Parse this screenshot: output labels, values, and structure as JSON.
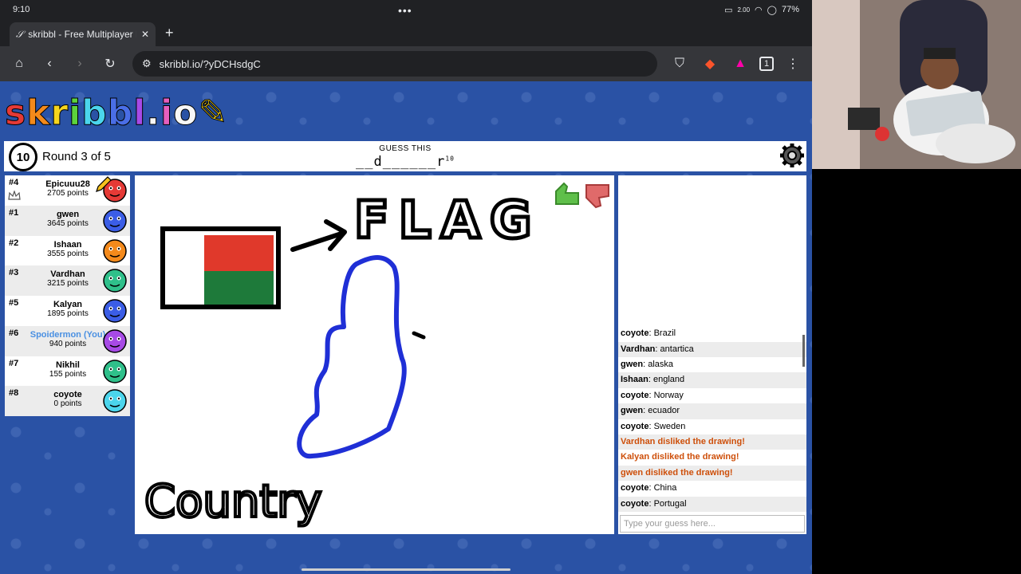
{
  "status": {
    "time": "9:10",
    "battery": "77%",
    "speed": "2.00"
  },
  "browser": {
    "tab_title": "skribbl - Free Multiplayer Drawing",
    "url": "skribbl.io/?yDCHsdgC"
  },
  "game": {
    "logo": [
      "s",
      "k",
      "r",
      "i",
      "b",
      "b",
      "l",
      ".",
      "i",
      "o"
    ],
    "logo_colors": [
      "#e53a36",
      "#f48a1b",
      "#f7d51d",
      "#5cd33c",
      "#4bd5ec",
      "#4a6ee6",
      "#a74ae6",
      ".",
      "#e55fbe",
      "#f7f7f7"
    ],
    "timer": "10",
    "round": "Round 3 of 5",
    "guess_label": "GUESS THIS",
    "hint": "__d______r",
    "hint_count": "10"
  },
  "players": [
    {
      "rank": "#4",
      "name": "Epicuuu28",
      "points": "2705 points",
      "color": "#e53a36"
    },
    {
      "rank": "#1",
      "name": "gwen",
      "points": "3645 points",
      "color": "#3b5de6"
    },
    {
      "rank": "#2",
      "name": "Ishaan",
      "points": "3555 points",
      "color": "#f48a1b"
    },
    {
      "rank": "#3",
      "name": "Vardhan",
      "points": "3215 points",
      "color": "#2fc08a"
    },
    {
      "rank": "#5",
      "name": "Kalyan",
      "points": "1895 points",
      "color": "#3b5de6"
    },
    {
      "rank": "#6",
      "name": "Spoidermon (You)",
      "points": "940 points",
      "color": "#a74ae6"
    },
    {
      "rank": "#7",
      "name": "Nikhil",
      "points": "155 points",
      "color": "#2fc08a"
    },
    {
      "rank": "#8",
      "name": "coyote",
      "points": "0 points",
      "color": "#4bd5ec"
    }
  ],
  "canvas": {
    "text_flag": "FLAG",
    "text_country": "Country",
    "flag_colors": [
      "#ffffff",
      "#e0392b",
      "#1e7a3a"
    ]
  },
  "chat": {
    "messages": [
      {
        "who": "coyote",
        "text": "Brazil",
        "system": false
      },
      {
        "who": "Vardhan",
        "text": "antartica",
        "system": false
      },
      {
        "who": "gwen",
        "text": "alaska",
        "system": false
      },
      {
        "who": "Ishaan",
        "text": "england",
        "system": false
      },
      {
        "who": "coyote",
        "text": "Norway",
        "system": false
      },
      {
        "who": "gwen",
        "text": "ecuador",
        "system": false
      },
      {
        "who": "coyote",
        "text": "Sweden",
        "system": false
      },
      {
        "who": "",
        "text": "Vardhan disliked the drawing!",
        "system": true
      },
      {
        "who": "",
        "text": "Kalyan disliked the drawing!",
        "system": true
      },
      {
        "who": "",
        "text": "gwen disliked the drawing!",
        "system": true
      },
      {
        "who": "coyote",
        "text": "China",
        "system": false
      },
      {
        "who": "coyote",
        "text": "Portugal",
        "system": false
      }
    ],
    "placeholder": "Type your guess here..."
  }
}
